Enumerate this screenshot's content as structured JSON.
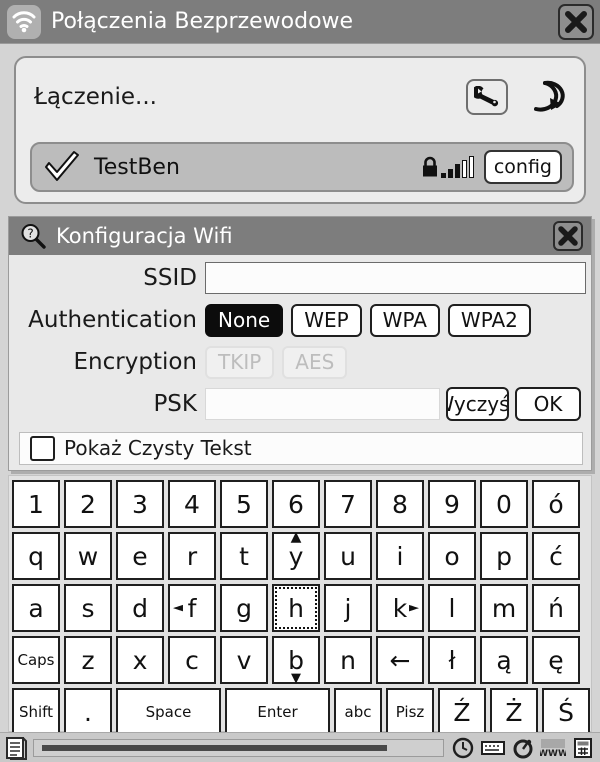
{
  "window": {
    "title": "Połączenia Bezprzewodowe",
    "icon": "wifi-icon",
    "close_label": "×"
  },
  "connection": {
    "status_text": "Łączenie...",
    "tool_button_icon": "wrench-icon",
    "refresh_button_icon": "refresh-icon",
    "network": {
      "name": "TestBen",
      "selected_icon": "checkmark-icon",
      "secured_icon": "lock-icon",
      "signal_bars_total": 5,
      "signal_bars_filled": 3,
      "config_label": "config"
    }
  },
  "dialog": {
    "title": "Konfiguracja Wifi",
    "icon": "magnifier-question-icon",
    "close_label": "×",
    "fields": {
      "ssid_label": "SSID",
      "ssid_value": "",
      "ssid_placeholder": "",
      "auth_label": "Authentication",
      "auth_options": [
        "None",
        "WEP",
        "WPA",
        "WPA2"
      ],
      "auth_selected": "None",
      "encryption_label": "Encryption",
      "encryption_options": [
        "TKIP",
        "AES"
      ],
      "encryption_enabled": false,
      "psk_label": "PSK",
      "psk_value": "",
      "psk_placeholder": ""
    },
    "buttons": {
      "clear_label": "Wyczyść",
      "ok_label": "OK"
    },
    "checkbox": {
      "label": "Pokaż Czysty Tekst",
      "checked": false
    }
  },
  "keyboard": {
    "focused_key": "h",
    "rows": [
      [
        {
          "label": "1"
        },
        {
          "label": "2"
        },
        {
          "label": "3"
        },
        {
          "label": "4"
        },
        {
          "label": "5"
        },
        {
          "label": "6"
        },
        {
          "label": "7"
        },
        {
          "label": "8"
        },
        {
          "label": "9"
        },
        {
          "label": "0"
        },
        {
          "label": "ó"
        }
      ],
      [
        {
          "label": "q"
        },
        {
          "label": "w"
        },
        {
          "label": "e"
        },
        {
          "label": "r"
        },
        {
          "label": "t"
        },
        {
          "label": "y",
          "arrow": "up"
        },
        {
          "label": "u"
        },
        {
          "label": "i"
        },
        {
          "label": "o"
        },
        {
          "label": "p"
        },
        {
          "label": "ć"
        }
      ],
      [
        {
          "label": "a"
        },
        {
          "label": "s"
        },
        {
          "label": "d"
        },
        {
          "label": "f",
          "arrow": "left"
        },
        {
          "label": "g"
        },
        {
          "label": "h",
          "focus": true
        },
        {
          "label": "j"
        },
        {
          "label": "k",
          "arrow": "right"
        },
        {
          "label": "l"
        },
        {
          "label": "m"
        },
        {
          "label": "ń"
        }
      ],
      [
        {
          "label": "Caps",
          "small": true
        },
        {
          "label": "z"
        },
        {
          "label": "x"
        },
        {
          "label": "c"
        },
        {
          "label": "v"
        },
        {
          "label": "b",
          "arrow": "down"
        },
        {
          "label": "n"
        },
        {
          "label": "←",
          "backspace": true
        },
        {
          "label": "ł"
        },
        {
          "label": "ą"
        },
        {
          "label": "ę"
        }
      ],
      [
        {
          "label": "Shift",
          "small": true
        },
        {
          "label": "."
        },
        {
          "label": "Space",
          "small": true,
          "wide": true
        },
        {
          "label": "Enter",
          "small": true,
          "wide": true
        },
        {
          "label": "abc",
          "small": true
        },
        {
          "label": "Pisz",
          "small": true
        },
        {
          "label": "Ź"
        },
        {
          "label": "Ż"
        },
        {
          "label": "Ś"
        }
      ]
    ]
  },
  "taskbar": {
    "document_icon": "document-icon",
    "ghost_text": "",
    "tray_icons": [
      "clock-icon",
      "keyboard-icon",
      "dial-icon",
      "www-icon",
      "calculator-icon"
    ]
  },
  "colors": {
    "titlebar_bg": "#7d7d7d",
    "titlebar_text": "#ffffff",
    "panel_bg": "#ececec",
    "dialog_bg": "#e9e9e9",
    "network_row_bg": "#bcbcbc",
    "key_bg": "#ffffff",
    "key_border": "#1f1f1f",
    "active_seg_bg": "#0c0c0c",
    "disabled_text": "#bdbdbd",
    "taskbar_bg": "#c9c9c9"
  }
}
